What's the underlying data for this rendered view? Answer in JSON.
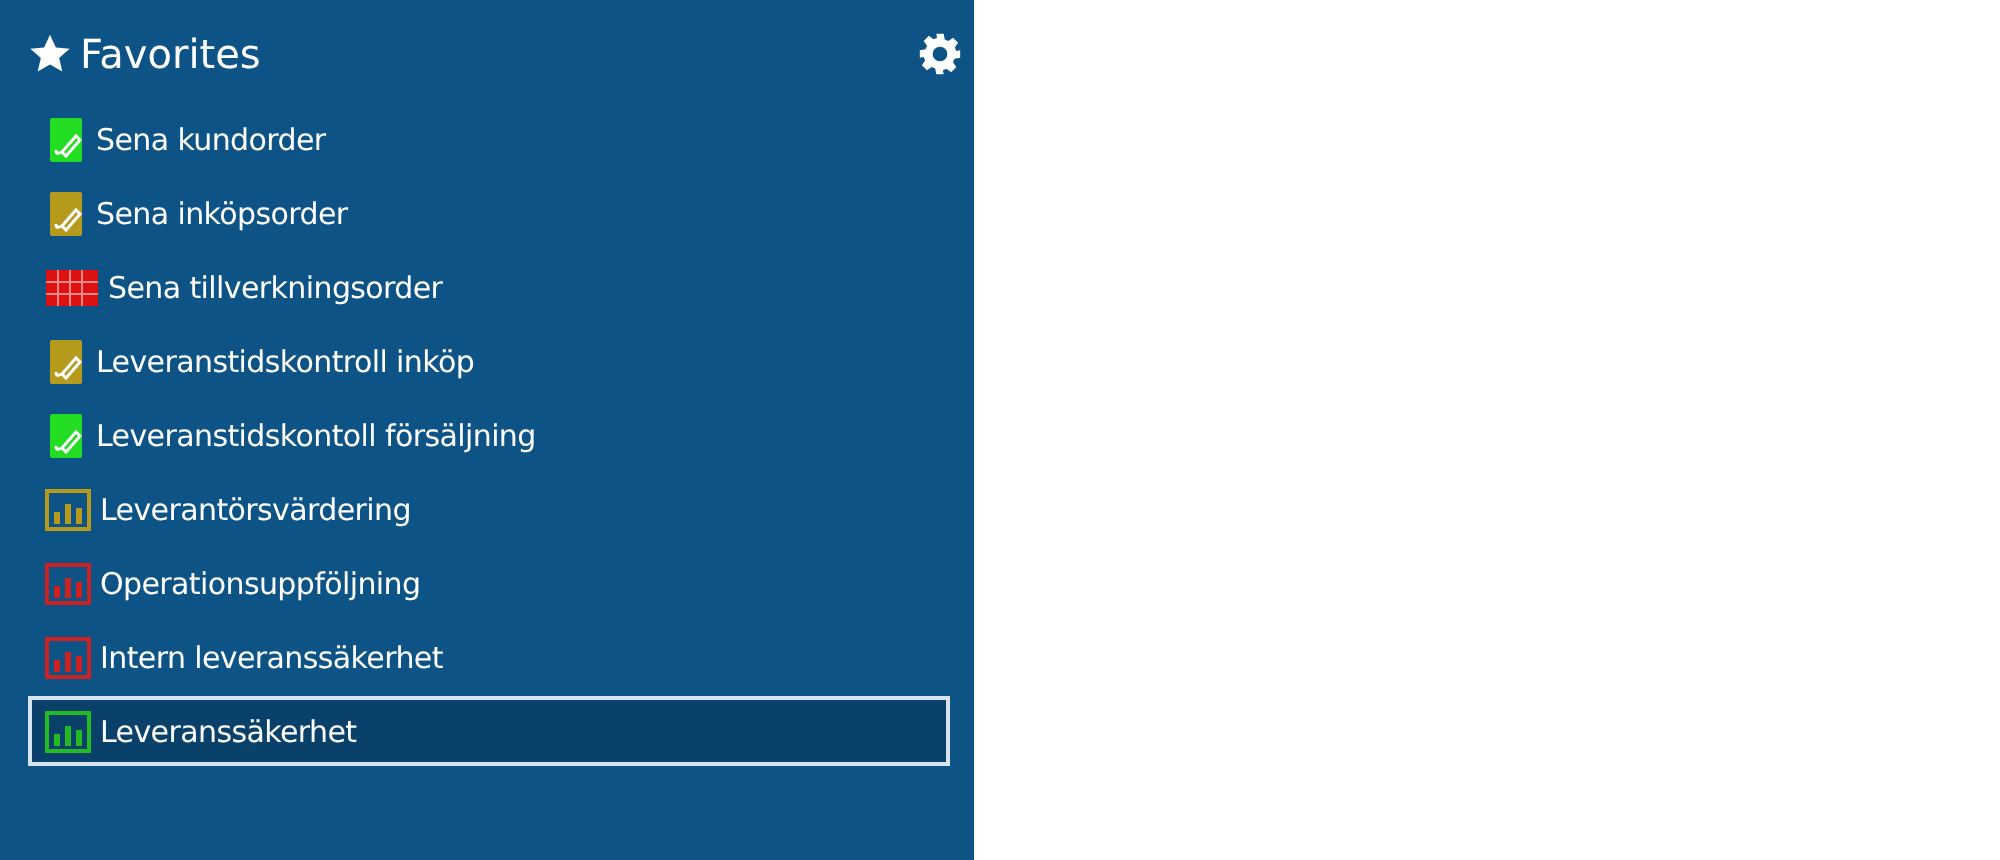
{
  "panel": {
    "title": "Favorites"
  },
  "items": [
    {
      "label": "Sena kundorder",
      "kind": "note",
      "color": "#22dd22",
      "selected": false
    },
    {
      "label": "Sena inköpsorder",
      "kind": "note",
      "color": "#b59a1c",
      "selected": false
    },
    {
      "label": "Sena tillverkningsorder",
      "kind": "calendar",
      "color": "#dd1111",
      "selected": false
    },
    {
      "label": "Leveranstidskontroll inköp",
      "kind": "note",
      "color": "#b59a1c",
      "selected": false
    },
    {
      "label": "Leveranstidskontoll försäljning",
      "kind": "note",
      "color": "#22dd22",
      "selected": false
    },
    {
      "label": "Leverantörsvärdering",
      "kind": "chart",
      "color": "#b59a1c",
      "selected": false
    },
    {
      "label": "Operationsuppföljning",
      "kind": "chart",
      "color": "#cc2222",
      "selected": false
    },
    {
      "label": "Intern leveranssäkerhet",
      "kind": "chart",
      "color": "#cc2222",
      "selected": false
    },
    {
      "label": "Leveranssäkerhet",
      "kind": "chart",
      "color": "#22bb22",
      "selected": true
    }
  ]
}
